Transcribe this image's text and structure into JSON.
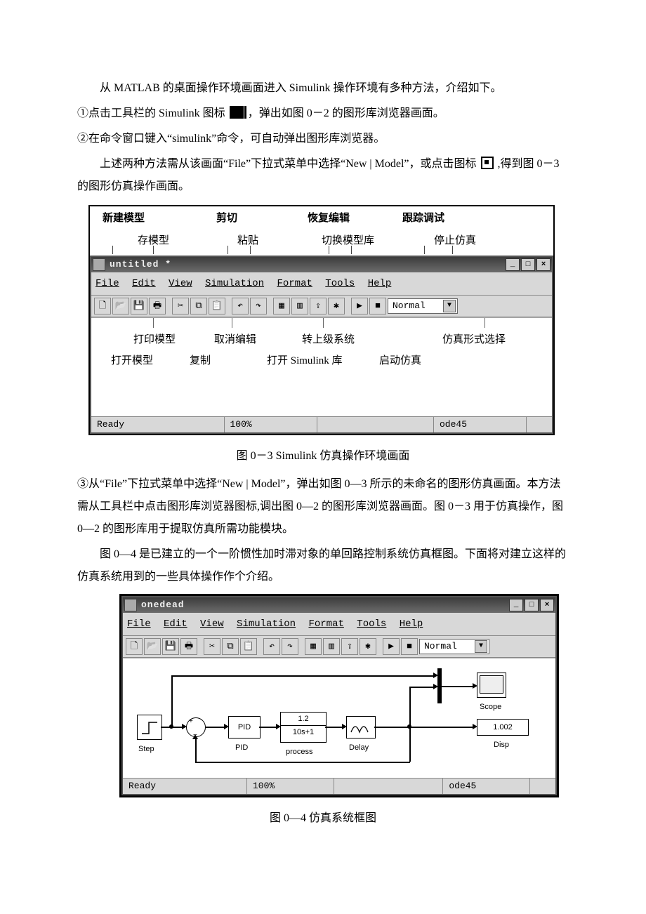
{
  "text": {
    "p1": "从 MATLAB 的桌面操作环境画面进入 Simulink 操作环境有多种方法，介绍如下。",
    "p2a": "①点击工具栏的 Simulink 图标 ",
    "p2b": "，弹出如图 0－2 的图形库浏览器画面。",
    "p3": "②在命令窗口键入“simulink”命令，可自动弹出图形库浏览器。",
    "p4a": "上述两种方法需从该画面“File”下拉式菜单中选择“New | Model”，或点击图标",
    "p4b": ",得到图 0－3 的图形仿真操作画面。",
    "cap1": "图 0－3 Simulink 仿真操作环境画面",
    "p5": "③从“File”下拉式菜单中选择“New | Model”，弹出如图 0—3 所示的未命名的图形仿真画面。本方法需从工具栏中点击图形库浏览器图标,调出图 0—2 的图形库浏览器画面。图 0－3 用于仿真操作，图 0—2 的图形库用于提取仿真所需功能模块。",
    "p6": "图 0—4 是已建立的一个一阶惯性加时滞对象的单回路控制系统仿真框图。下面将对建立这样的仿真系统用到的一些具体操作作个介绍。",
    "cap2": "图 0—4 仿真系统框图"
  },
  "callouts_top": {
    "r1": [
      "新建模型",
      "剪切",
      "恢复编辑",
      "跟踪调试"
    ],
    "r2": [
      "存模型",
      "粘贴",
      "切换模型库",
      "停止仿真"
    ]
  },
  "callouts_in": {
    "r1": [
      "打印模型",
      "取消编辑",
      "转上级系统",
      "仿真形式选择"
    ],
    "r2": [
      "打开模型",
      "复制",
      "打开 Simulink 库",
      "启动仿真"
    ]
  },
  "win3": {
    "title": "untitled *",
    "menus": [
      "File",
      "Edit",
      "View",
      "Simulation",
      "Format",
      "Tools",
      "Help"
    ],
    "mode": "Normal",
    "status": {
      "left": "Ready",
      "zoom": "100%",
      "solver": "ode45"
    }
  },
  "win4": {
    "title": "onedead",
    "menus": [
      "File",
      "Edit",
      "View",
      "Simulation",
      "Format",
      "Tools",
      "Help"
    ],
    "mode": "Normal",
    "status": {
      "left": "Ready",
      "zoom": "100%",
      "solver": "ode45"
    },
    "blocks": {
      "step": "Step",
      "pid_in": "PID",
      "pid_lbl": "PID",
      "tf_num": "1.2",
      "tf_den": "10s+1",
      "tf_lbl": "process",
      "delay": "Delay",
      "scope": "Scope",
      "disp_val": "1.002",
      "disp": "Disp"
    }
  }
}
